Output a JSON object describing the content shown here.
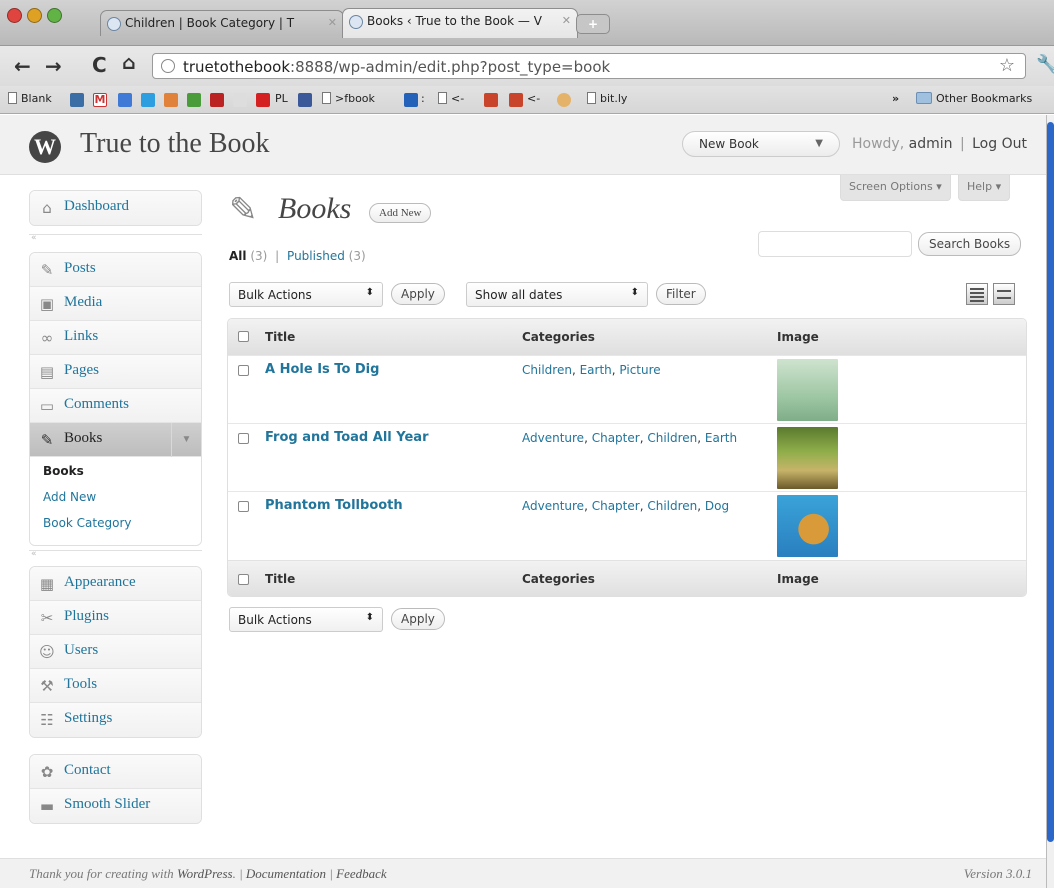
{
  "browser": {
    "tabs": [
      {
        "label": "Children | Book Category | T"
      },
      {
        "label": "Books ‹ True to the Book — V"
      }
    ],
    "url_host": "truetothebook",
    "url_rest": ":8888/wp-admin/edit.php?post_type=book",
    "bookmarks": [
      "Blank",
      "PL",
      ">fbook",
      ":",
      "<-",
      "<-",
      "bit.ly"
    ],
    "bookmark_overflow": "»",
    "other_bookmarks": "Other Bookmarks"
  },
  "wp": {
    "logo": "W",
    "site_title": "True to the Book",
    "fav_action": "New Book",
    "howdy_prefix": "Howdy, ",
    "user": "admin",
    "logout": "Log Out",
    "screen_options": "Screen Options",
    "help": "Help",
    "menu_top": [
      {
        "label": "Dashboard",
        "icon": "home-icon"
      }
    ],
    "menu_main": [
      {
        "label": "Posts",
        "icon": "pushpin-icon"
      },
      {
        "label": "Media",
        "icon": "media-icon"
      },
      {
        "label": "Links",
        "icon": "link-icon"
      },
      {
        "label": "Pages",
        "icon": "pages-icon"
      },
      {
        "label": "Comments",
        "icon": "comment-icon"
      },
      {
        "label": "Books",
        "icon": "pushpin-icon"
      }
    ],
    "books_submenu": [
      "Books",
      "Add New",
      "Book Category"
    ],
    "menu_settings": [
      {
        "label": "Appearance",
        "icon": "appearance-icon"
      },
      {
        "label": "Plugins",
        "icon": "plugin-icon"
      },
      {
        "label": "Users",
        "icon": "users-icon"
      },
      {
        "label": "Tools",
        "icon": "tools-icon"
      },
      {
        "label": "Settings",
        "icon": "settings-icon"
      }
    ],
    "menu_extra": [
      {
        "label": "Contact",
        "icon": "contact-icon"
      },
      {
        "label": "Smooth Slider",
        "icon": "slider-icon"
      }
    ],
    "page_title": "Books",
    "add_new": "Add New",
    "filters": {
      "all": "All",
      "all_count": "(3)",
      "published": "Published",
      "published_count": "(3)"
    },
    "search_button": "Search Books",
    "bulk_actions": "Bulk Actions",
    "apply": "Apply",
    "dates": "Show all dates",
    "filter": "Filter",
    "columns": {
      "title": "Title",
      "categories": "Categories",
      "image": "Image"
    },
    "rows": [
      {
        "title": "A Hole Is To Dig",
        "categories": [
          "Children",
          "Earth",
          "Picture"
        ]
      },
      {
        "title": "Frog and Toad All Year",
        "categories": [
          "Adventure",
          "Chapter",
          "Children",
          "Earth"
        ]
      },
      {
        "title": "Phantom Tollbooth",
        "categories": [
          "Adventure",
          "Chapter",
          "Children",
          "Dog"
        ]
      }
    ],
    "footer": {
      "thanks_prefix": "Thank you for creating with ",
      "wordpress": "WordPress",
      "documentation": "Documentation",
      "feedback": "Feedback",
      "version": "Version 3.0.1"
    }
  },
  "colors": {
    "link": "#21759b",
    "header_bg": "#f1f1f1",
    "scroll_thumb": "#2b67c9"
  }
}
